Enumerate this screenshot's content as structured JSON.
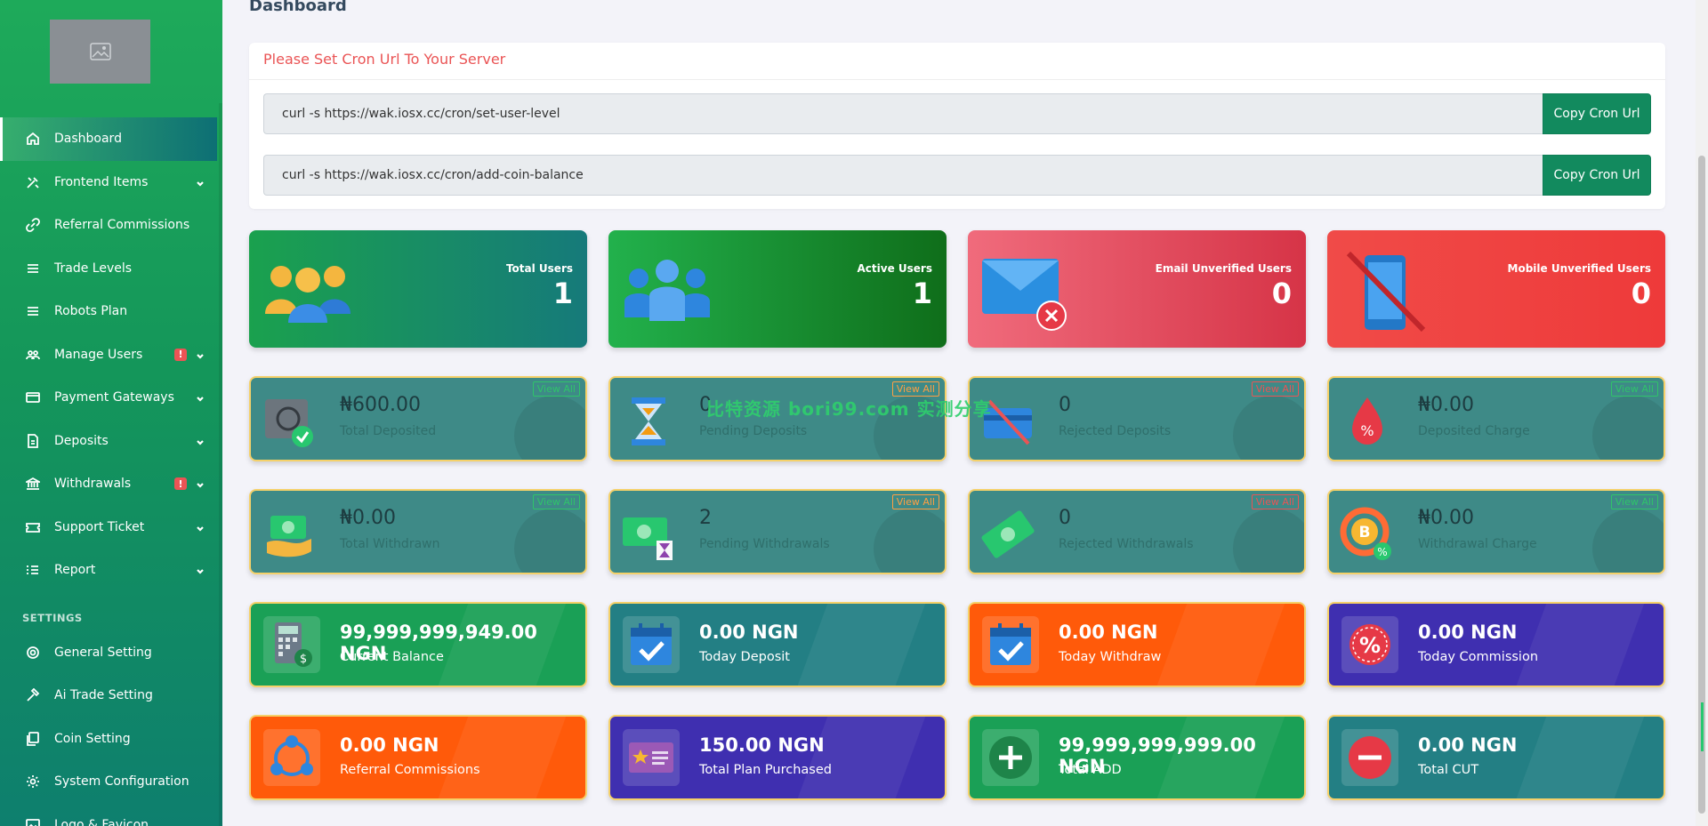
{
  "page": {
    "title": "Dashboard",
    "watermark": "比特资源 bori99.com 实测分享"
  },
  "sidebar": {
    "items": [
      {
        "label": "Dashboard"
      },
      {
        "label": "Frontend Items"
      },
      {
        "label": "Referral Commissions"
      },
      {
        "label": "Trade Levels"
      },
      {
        "label": "Robots Plan"
      },
      {
        "label": "Manage Users",
        "badge": "!"
      },
      {
        "label": "Payment Gateways"
      },
      {
        "label": "Deposits"
      },
      {
        "label": "Withdrawals",
        "badge": "!"
      },
      {
        "label": "Support Ticket"
      },
      {
        "label": "Report"
      }
    ],
    "settings_label": "SETTINGS",
    "settings_items": [
      {
        "label": "General Setting"
      },
      {
        "label": "Ai Trade Setting"
      },
      {
        "label": "Coin Setting"
      },
      {
        "label": "System Configuration"
      },
      {
        "label": "Logo & Favicon"
      }
    ]
  },
  "cron": {
    "title": "Please Set Cron Url To Your Server",
    "rows": [
      {
        "url": "curl -s https://wak.iosx.cc/cron/set-user-level",
        "button": "Copy Cron Url"
      },
      {
        "url": "curl -s https://wak.iosx.cc/cron/add-coin-balance",
        "button": "Copy Cron Url"
      }
    ]
  },
  "users": [
    {
      "label": "Total Users",
      "value": "1"
    },
    {
      "label": "Active Users",
      "value": "1"
    },
    {
      "label": "Email Unverified Users",
      "value": "0"
    },
    {
      "label": "Mobile Unverified Users",
      "value": "0"
    }
  ],
  "deposits": [
    {
      "amount": "₦600.00",
      "label": "Total Deposited",
      "view": "View All"
    },
    {
      "amount": "0",
      "label": "Pending Deposits",
      "view": "View All"
    },
    {
      "amount": "0",
      "label": "Rejected Deposits",
      "view": "View All"
    },
    {
      "amount": "₦0.00",
      "label": "Deposited Charge",
      "view": "View All"
    }
  ],
  "withdrawals": [
    {
      "amount": "₦0.00",
      "label": "Total Withdrawn",
      "view": "View All"
    },
    {
      "amount": "2",
      "label": "Pending Withdrawals",
      "view": "View All"
    },
    {
      "amount": "0",
      "label": "Rejected Withdrawals",
      "view": "View All"
    },
    {
      "amount": "₦0.00",
      "label": "Withdrawal Charge",
      "view": "View All"
    }
  ],
  "balances": [
    {
      "amount": "99,999,999,949.00 NGN",
      "label": "Current Balance"
    },
    {
      "amount": "0.00 NGN",
      "label": "Today Deposit"
    },
    {
      "amount": "0.00 NGN",
      "label": "Today Withdraw"
    },
    {
      "amount": "0.00 NGN",
      "label": "Today Commission"
    },
    {
      "amount": "0.00 NGN",
      "label": "Referral Commissions"
    },
    {
      "amount": "150.00 NGN",
      "label": "Total Plan Purchased"
    },
    {
      "amount": "99,999,999,999.00 NGN",
      "label": "Total ADD"
    },
    {
      "amount": "0.00 NGN",
      "label": "Total CUT"
    }
  ]
}
